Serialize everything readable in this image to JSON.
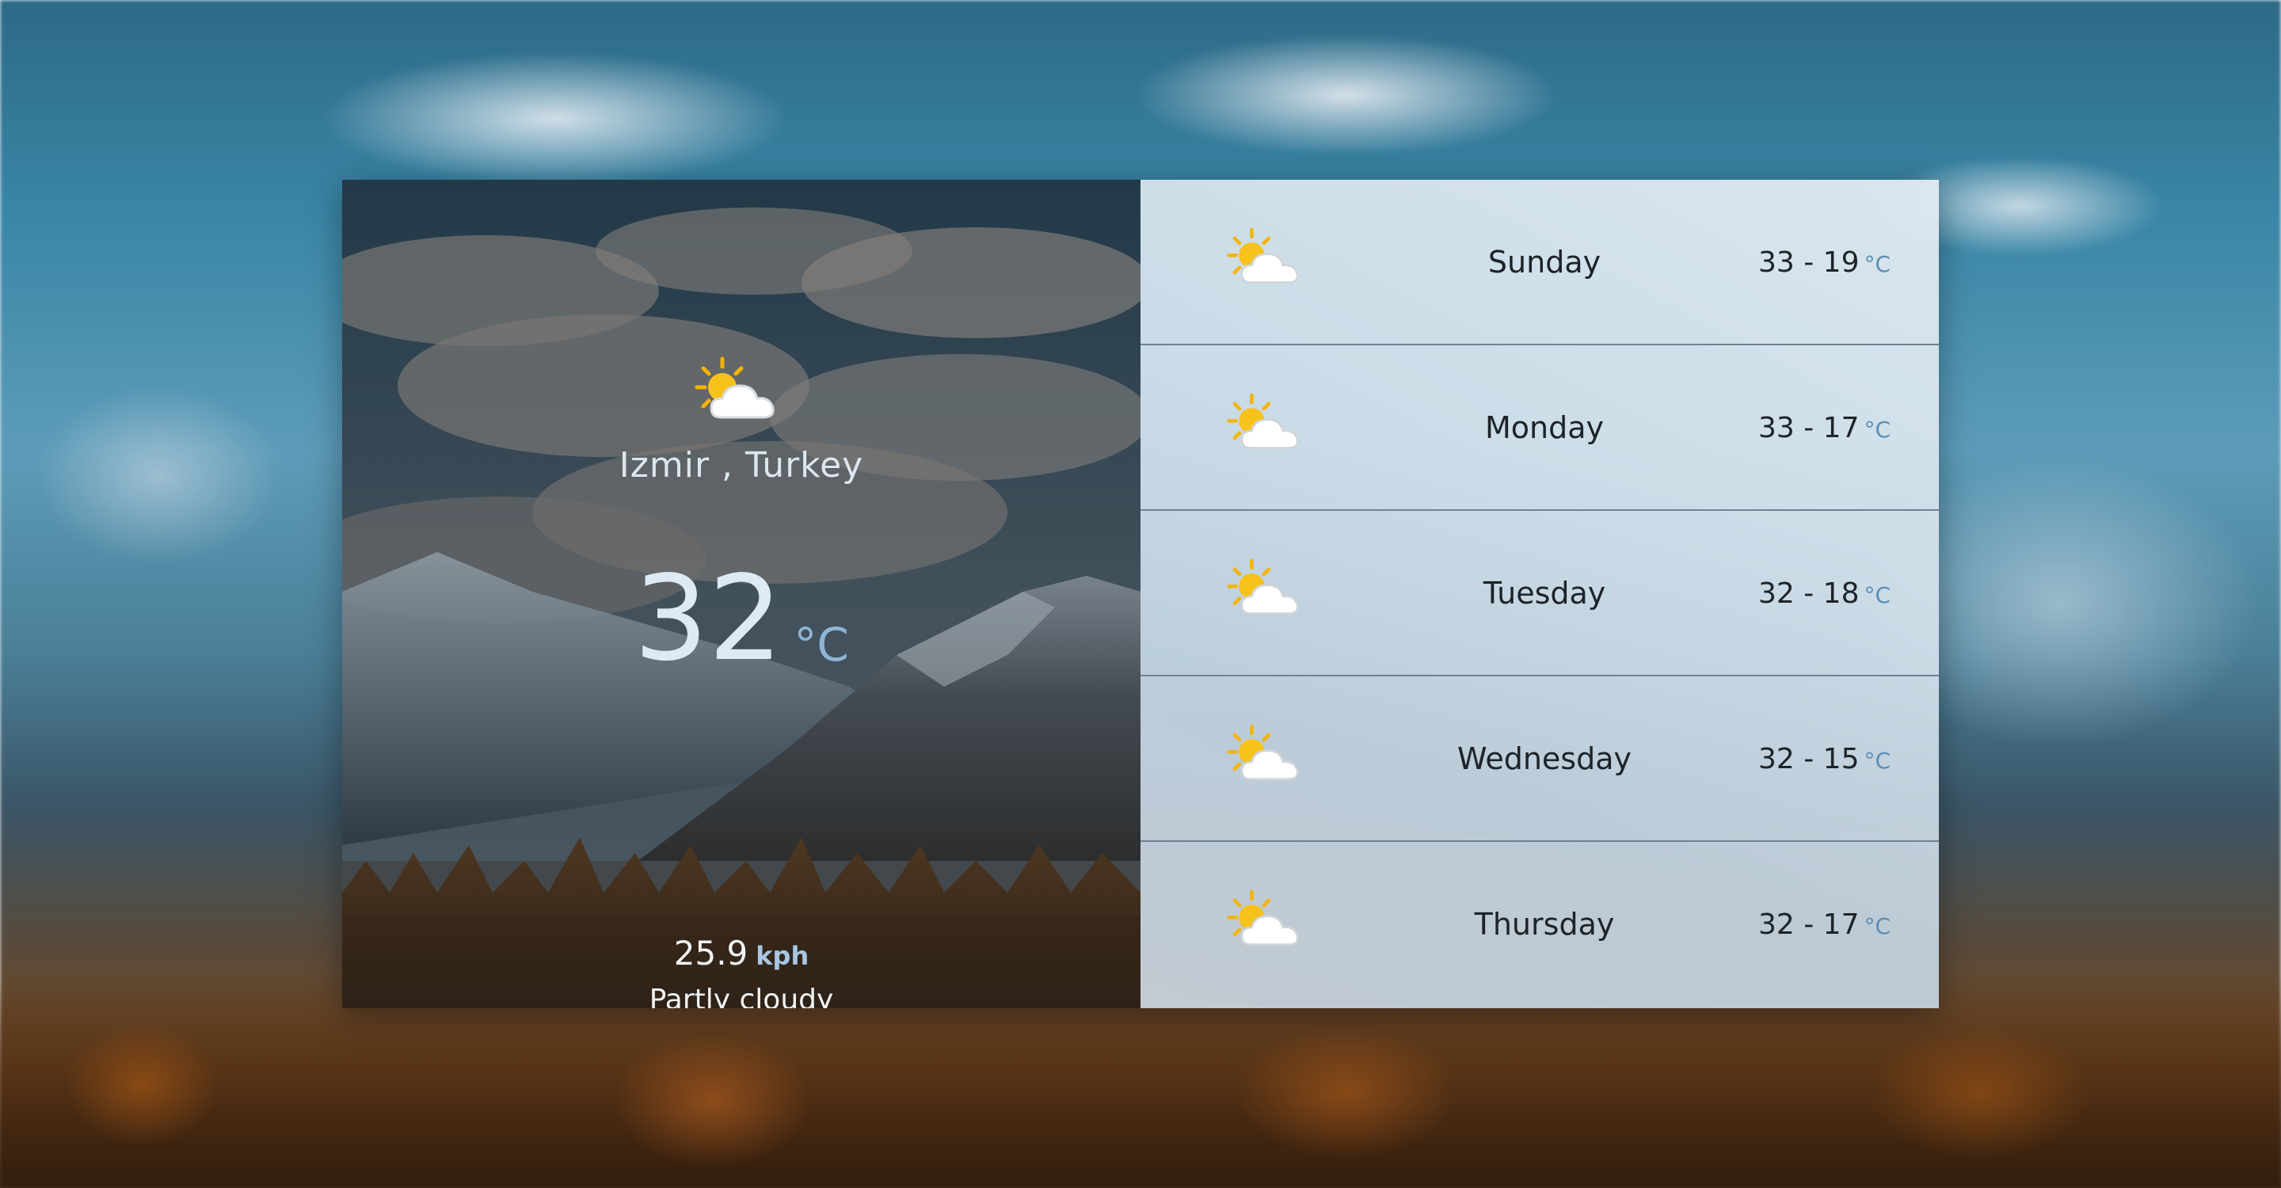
{
  "current": {
    "icon": "partly-cloudy-icon",
    "location": "Izmir , Turkey",
    "temperature": "32",
    "temp_unit": "°C",
    "wind_speed": "25.9",
    "wind_unit": "kph",
    "condition": "Partly cloudy"
  },
  "forecast": [
    {
      "day": "Sunday",
      "range": "33 - 19",
      "unit": "°C",
      "icon": "partly-cloudy-icon"
    },
    {
      "day": "Monday",
      "range": "33 - 17",
      "unit": "°C",
      "icon": "partly-cloudy-icon"
    },
    {
      "day": "Tuesday",
      "range": "32 - 18",
      "unit": "°C",
      "icon": "partly-cloudy-icon"
    },
    {
      "day": "Wednesday",
      "range": "32 - 15",
      "unit": "°C",
      "icon": "partly-cloudy-icon"
    },
    {
      "day": "Thursday",
      "range": "32 - 17",
      "unit": "°C",
      "icon": "partly-cloudy-icon"
    }
  ],
  "colors": {
    "accent_unit": "#8fb5d5",
    "forecast_unit": "#5b8db5",
    "divider": "#6f8391"
  }
}
